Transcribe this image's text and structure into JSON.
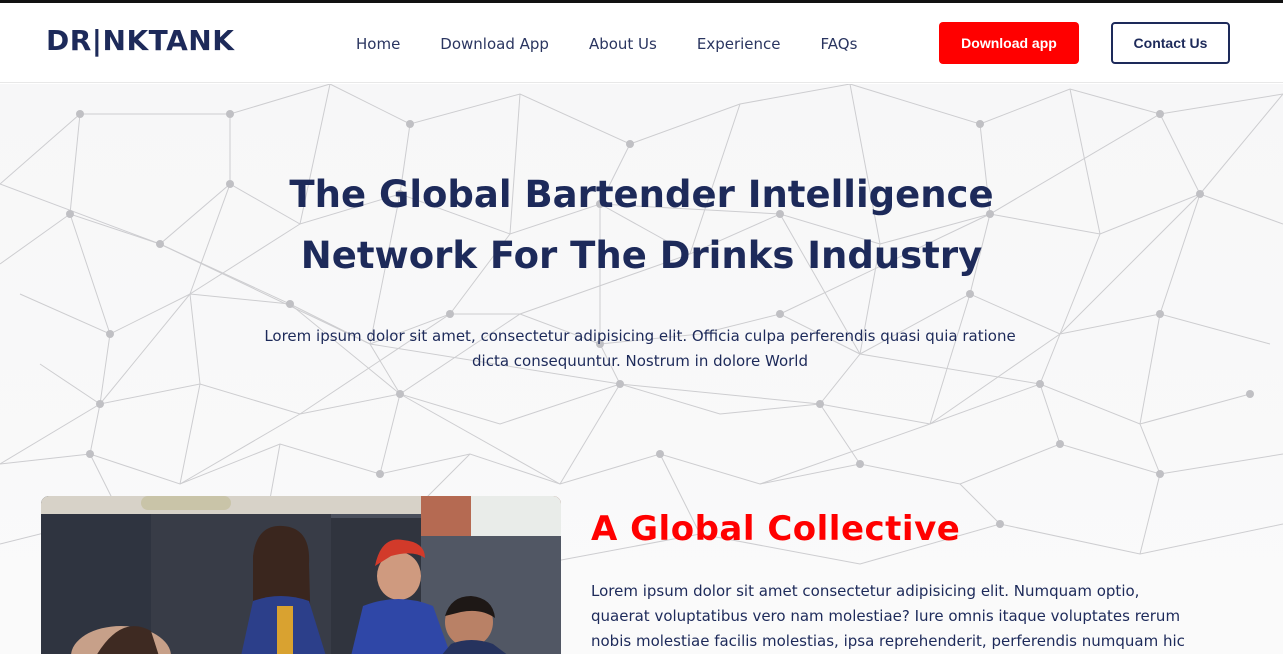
{
  "brand": {
    "logo_text": "DR|NKTANK"
  },
  "nav": {
    "links": [
      "Home",
      "Download App",
      "About Us",
      "Experience",
      "FAQs"
    ],
    "download_button": "Download app",
    "contact_button": "Contact Us"
  },
  "hero": {
    "title_line1": "The Global Bartender Intelligence",
    "title_line2": "Network For The Drinks Industry",
    "subtitle_line1": "Lorem ipsum dolor sit amet, consectetur adipisicing elit. Officia culpa perferendis quasi quia ratione",
    "subtitle_line2": "dicta consequuntur. Nostrum in dolore World"
  },
  "collective": {
    "title": "A Global Collective",
    "text_line1": "Lorem ipsum dolor sit amet consectetur adipisicing elit. Numquam optio,",
    "text_line2": "quaerat voluptatibus vero nam molestiae? Iure omnis itaque voluptates rerum",
    "text_line3": "nobis molestiae facilis molestias, ipsa reprehenderit, perferendis numquam hic"
  },
  "colors": {
    "navy": "#1d2a5a",
    "red": "#ff0000",
    "background": "#f7f7f8"
  }
}
